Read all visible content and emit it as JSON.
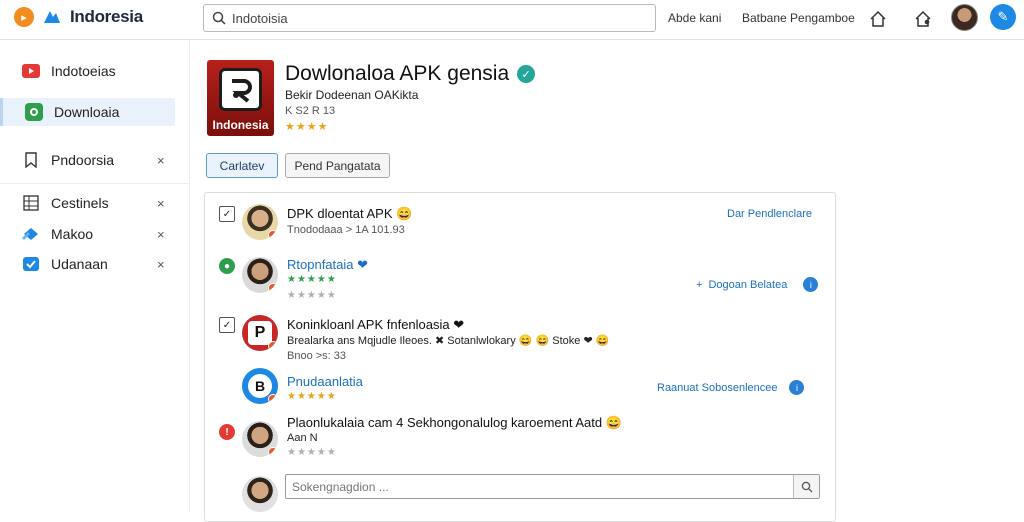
{
  "topbar": {
    "brand": "Indoresia",
    "search_value": "Indotoisia",
    "link_1": "Abde kani",
    "link_2": "Batbane Pengamboe"
  },
  "sidebar": {
    "items": [
      {
        "label": "Indotoeias",
        "icon": "play-icon"
      },
      {
        "label": "Downloaia",
        "icon": "android-icon"
      },
      {
        "label": "Pndoorsia",
        "icon": "bookmark-icon",
        "close": "×"
      },
      {
        "label": "Cestinels",
        "icon": "grid-icon",
        "close": "×"
      },
      {
        "label": "Makoo",
        "icon": "puzzle-icon",
        "close": "×"
      },
      {
        "label": "Udanaan",
        "icon": "shield-icon",
        "close": "×"
      }
    ]
  },
  "app": {
    "icon_caption": "Indonesia",
    "title": "Dowlonaloa APK gensia",
    "subtitle": "Bekir Dodeenan OAKikta",
    "meta": "K S2 R 13",
    "stars": "★★★★"
  },
  "buttons": {
    "primary": "Carlatev",
    "secondary": "Pend Pangatata"
  },
  "rows": [
    {
      "title": "DPK dloentat APK 😄",
      "sub": "Tnododaaa > 1A 101.93",
      "action": "Dar Pendlenclare"
    },
    {
      "title": "Rtopnfataia ❤",
      "stars_green": "★★★★★",
      "stars_gray": "★★★★★",
      "action": "Dogoan Belatea"
    },
    {
      "title": "Koninkloanl APK fnfenloasia ❤",
      "sub": "Brealarka ans  Mqjudle Ileoes.  ✖  Sotanlwlokary 😄  😄 Stoke ❤ 😄",
      "sub2": "Bnoo >s: 33",
      "avatar_letter": "P"
    },
    {
      "title": "Pnudaanlatia",
      "stars": "★★★★★",
      "action": "Raanuat  Sobosenlencee",
      "avatar_letter": "B"
    },
    {
      "title": "Plaonlukalaia cam 4 Sekhongonalulog karoement Aatd 😄",
      "sub": "Aan N",
      "stars": "★★★★★"
    }
  ],
  "comment": {
    "placeholder": "Sokengnagdion ..."
  }
}
